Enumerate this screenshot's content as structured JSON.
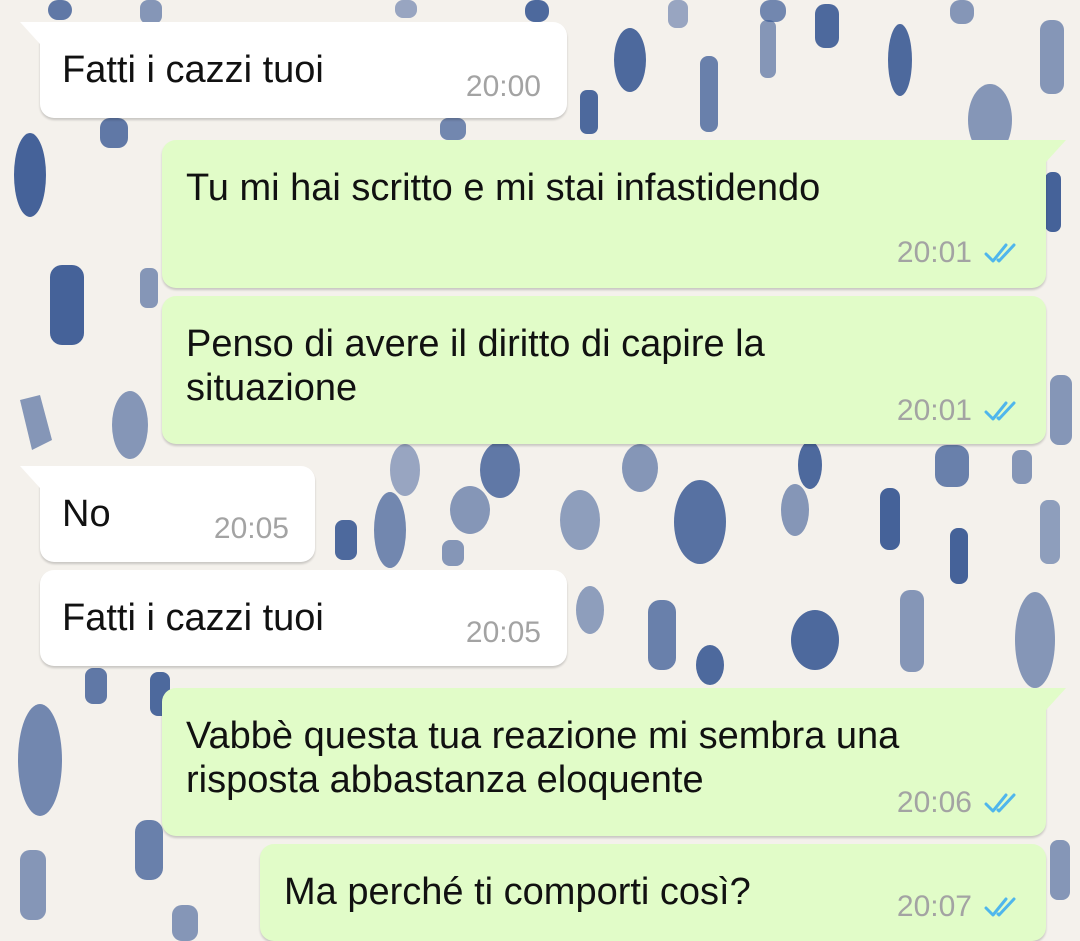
{
  "conversation": {
    "colors": {
      "incoming_bubble": "#ffffff",
      "outgoing_bubble": "#e1fcc8",
      "timestamp": "#a3a3a3",
      "read_ticks": "#4fb6ec",
      "wallpaper_background": "#f4f1ec",
      "wallpaper_strokes": "#3b5a95"
    },
    "messages": [
      {
        "direction": "incoming",
        "text": "Fatti i cazzi tuoi",
        "time": "20:00"
      },
      {
        "direction": "outgoing",
        "text": "Tu mi hai scritto e mi stai infastidendo",
        "time": "20:01",
        "status": "read",
        "status_icon": "double-check-icon"
      },
      {
        "direction": "outgoing",
        "text": "Penso di avere il diritto di capire la situazione",
        "time": "20:01",
        "status": "read",
        "status_icon": "double-check-icon"
      },
      {
        "direction": "incoming",
        "text": "No",
        "time": "20:05"
      },
      {
        "direction": "incoming",
        "text": "Fatti i cazzi tuoi",
        "time": "20:05"
      },
      {
        "direction": "outgoing",
        "text": "Vabbè questa tua reazione mi sembra una risposta abbastanza eloquente",
        "time": "20:06",
        "status": "read",
        "status_icon": "double-check-icon"
      },
      {
        "direction": "outgoing",
        "text": "Ma perché ti comporti così?",
        "time": "20:07",
        "status": "read",
        "status_icon": "double-check-icon"
      }
    ]
  }
}
